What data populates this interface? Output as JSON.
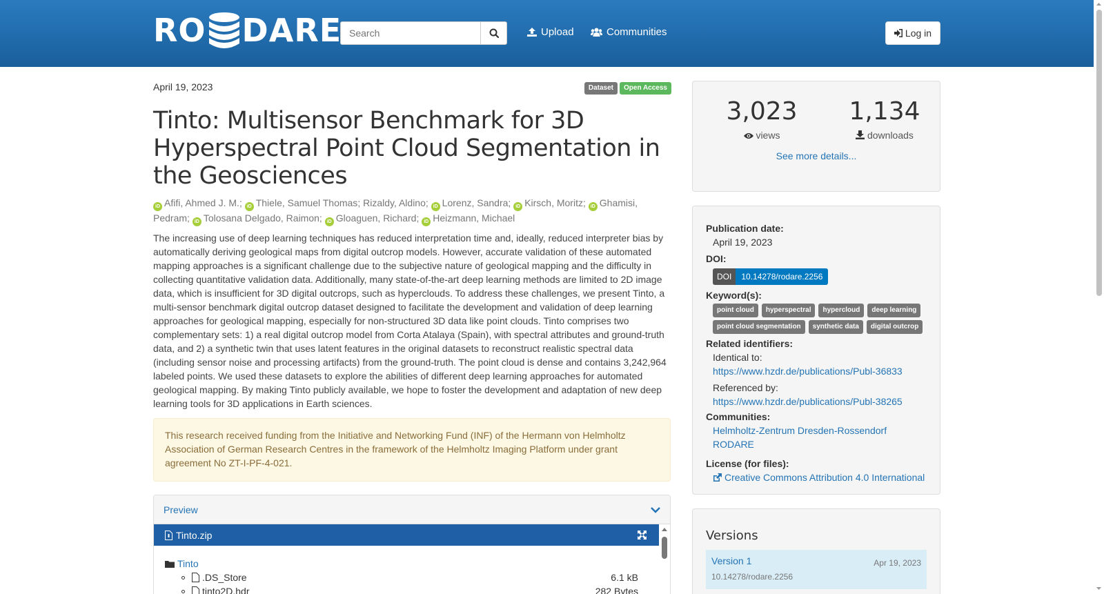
{
  "header": {
    "logo_left": "RO",
    "logo_right": "DARE",
    "search_placeholder": "Search",
    "upload_label": "Upload",
    "communities_label": "Communities",
    "login_label": "Log in"
  },
  "record": {
    "date": "April 19, 2023",
    "badges": [
      "Dataset",
      "Open Access"
    ],
    "title": "Tinto: Multisensor Benchmark for 3D Hyperspectral Point Cloud Segmentation in the Geosciences",
    "authors": [
      {
        "name": "Afifi, Ahmed J. M.",
        "orcid": true
      },
      {
        "name": "Thiele, Samuel Thomas",
        "orcid": true
      },
      {
        "name": "Rizaldy, Aldino",
        "orcid": false
      },
      {
        "name": "Lorenz, Sandra",
        "orcid": true
      },
      {
        "name": "Kirsch, Moritz",
        "orcid": true
      },
      {
        "name": "Ghamisi, Pedram",
        "orcid": true
      },
      {
        "name": "Tolosana Delgado, Raimon",
        "orcid": true
      },
      {
        "name": "Gloaguen, Richard",
        "orcid": true
      },
      {
        "name": "Heizmann, Michael",
        "orcid": true
      }
    ],
    "abstract": "The increasing use of deep learning techniques has reduced interpretation time and, ideally, reduced interpreter bias by automatically deriving geological maps from digital outcrop models. However, accurate validation of these automated mapping approaches is a significant challenge due to the subjective nature of geological mapping and the difficulty in collecting quantitative validation data. Additionally, many state-of-the-art deep learning methods are limited to 2D image data, which is insufficient for 3D digital outcrops, such as hyperclouds. To address these challenges, we present Tinto, a multi-sensor benchmark digital outcrop dataset designed to facilitate the development and validation of deep learning approaches for geological mapping, especially for non-structured 3D data like point clouds. Tinto comprises two complementary sets: 1) a real digital outcrop model from Corta Atalaya (Spain), with spectral attributes and ground-truth data, and 2) a synthetic twin that uses latent features in the original datasets to reconstruct realistic spectral data (including sensor noise and processing artifacts) from the ground-truth. The point cloud is dense and contains  3,242,964 labeled points. We used these datasets to explore the abilities of different deep learning approaches for automated geological mapping. By making Tinto publicly available, we hope to foster the development and adaptation of new deep learning tools for 3D applications in Earth sciences.",
    "funding": "This research received funding from the Initiative and Networking Fund (INF) of the Hermann von Helmholtz Association of German Research Centres in the framework of the Helmholtz Imaging Platform under grant agreement No ZT-I-PF-4-021."
  },
  "preview": {
    "label": "Preview",
    "file": "Tinto.zip",
    "folder": "Tinto",
    "files": [
      {
        "name": ".DS_Store",
        "size": "6.1 kB"
      },
      {
        "name": "tinto2D.hdr",
        "size": "282 Bytes"
      }
    ]
  },
  "stats": {
    "views": "3,023",
    "views_label": "views",
    "downloads": "1,134",
    "downloads_label": "downloads",
    "see_more": "See more details..."
  },
  "meta": {
    "pub_date_label": "Publication date:",
    "pub_date": "April 19, 2023",
    "doi_label": "DOI:",
    "doi_prefix": "DOI",
    "doi": "10.14278/rodare.2256",
    "keywords_label": "Keyword(s):",
    "keywords": [
      "point cloud",
      "hyperspectral",
      "hypercloud",
      "deep learning",
      "point cloud segmentation",
      "synthetic data",
      "digital outcrop"
    ],
    "related_label": "Related identifiers:",
    "identical_label": "Identical to:",
    "identical_url": "https://www.hzdr.de/publications/Publ-36833",
    "referenced_label": "Referenced by:",
    "referenced_url": "https://www.hzdr.de/publications/Publ-38265",
    "communities_label": "Communities:",
    "communities": [
      "Helmholtz-Zentrum Dresden-Rossendorf",
      "RODARE"
    ],
    "license_label": "License (for files):",
    "license": "Creative Commons Attribution 4.0 International"
  },
  "versions": {
    "title": "Versions",
    "items": [
      {
        "label": "Version 1",
        "date": "Apr 19, 2023",
        "doi": "10.14278/rodare.2256"
      }
    ]
  },
  "colors": {
    "header": "#1b65a6",
    "link": "#2474b5",
    "open_access": "#5cb85c",
    "doi_blue": "#0079c1",
    "orcid": "#a6ce39"
  }
}
